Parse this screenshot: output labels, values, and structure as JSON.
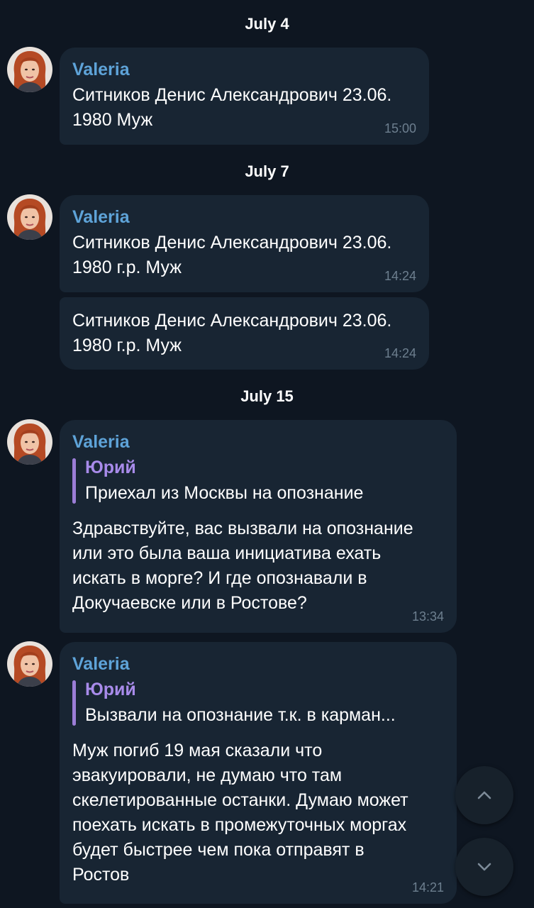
{
  "dates": [
    "July 4",
    "July 7",
    "July 15"
  ],
  "messages": [
    {
      "sender": "Valeria",
      "text": "Ситников Денис Александрович 23.06.\n1980 Муж",
      "time": "15:00"
    },
    {
      "sender": "Valeria",
      "text": "Ситников Денис Александрович 23.06.\n1980 г.р. Муж",
      "time": "14:24"
    },
    {
      "text": "Ситников Денис Александрович 23.06.\n1980 г.р. Муж",
      "time": "14:24"
    },
    {
      "sender": "Valeria",
      "reply": {
        "author": "Юрий",
        "text": "Приехал из Москвы на опознание"
      },
      "text": "Здравствуйте, вас вызвали на опознание\nили это была ваша инициатива ехать\nискать в морге? И где опознавали в\nДокучаевске или в Ростове?",
      "time": "13:34"
    },
    {
      "sender": "Valeria",
      "reply": {
        "author": "Юрий",
        "text": "Вызвали на опознание т.к. в карман..."
      },
      "text": "Муж погиб 19 мая сказали что\nэвакуировали, не думаю что там\nскелетированные останки. Думаю может\nпоехать искать в промежуточных моргах\nбудет быстрее чем пока отправят в\nРостов",
      "time": "14:21"
    }
  ],
  "icons": {
    "avatar": "avatar-valeria",
    "scroll_up": "chevron-up-icon",
    "scroll_down": "chevron-down-icon"
  },
  "colors": {
    "background": "#0e1621",
    "bubble": "#182533",
    "sender_name": "#5ea3d8",
    "reply_author": "#a88bea",
    "time": "#6d7f8f"
  }
}
